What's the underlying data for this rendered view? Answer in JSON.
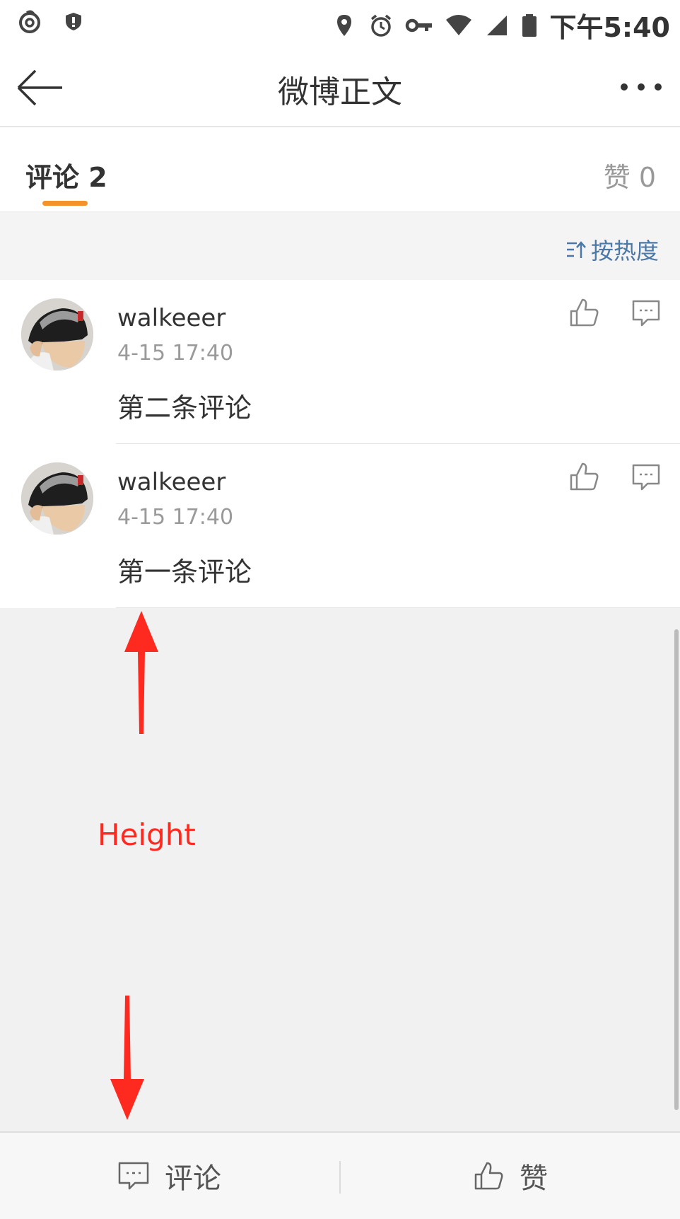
{
  "status_bar": {
    "time": "下午5:40",
    "icons": [
      "netease-music-icon",
      "shield-icon",
      "location-icon",
      "alarm-icon",
      "vpn-key-icon",
      "wifi-icon",
      "signal-icon",
      "battery-icon"
    ]
  },
  "nav": {
    "title": "微博正文",
    "back_icon": "arrow-left-icon",
    "more_icon": "more-dots-icon"
  },
  "tabs": {
    "comments_label": "评论 2",
    "likes_label": "赞 0",
    "active_color": "#f5932a"
  },
  "sort": {
    "label": "按热度",
    "icon": "sort-icon",
    "color": "#4a78a8"
  },
  "comments": [
    {
      "username": "walkeeer",
      "time": "4-15 17:40",
      "text": "第二条评论"
    },
    {
      "username": "walkeeer",
      "time": "4-15 17:40",
      "text": "第一条评论"
    }
  ],
  "annotation": {
    "label": "Height",
    "color": "#ff2a1f"
  },
  "bottom_bar": {
    "comment_label": "评论",
    "like_label": "赞"
  }
}
